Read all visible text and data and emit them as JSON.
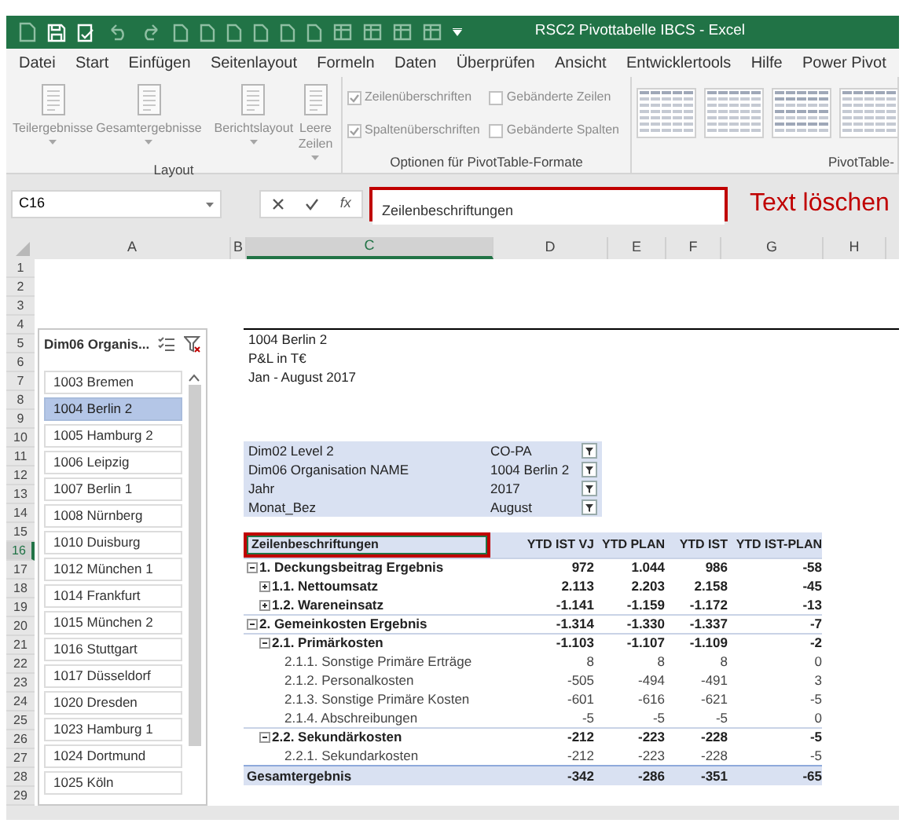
{
  "window": {
    "title": "RSC2 Pivottabelle IBCS  -  Excel"
  },
  "menu": [
    "Datei",
    "Start",
    "Einfügen",
    "Seitenlayout",
    "Formeln",
    "Daten",
    "Überprüfen",
    "Ansicht",
    "Entwicklertools",
    "Hilfe",
    "Power Pivot"
  ],
  "ribbon": {
    "groups": [
      {
        "label": "Layout",
        "kind": "buttons",
        "buttons": [
          {
            "label": "Teilergebnisse",
            "dropdown": true,
            "disabled": true
          },
          {
            "label": "Gesamtergebnisse",
            "dropdown": true,
            "disabled": true
          },
          {
            "label": "Berichtslayout",
            "dropdown": true,
            "disabled": true
          },
          {
            "label": "Leere Zeilen",
            "dropdown": true,
            "disabled": true
          }
        ]
      },
      {
        "label": "Optionen für PivotTable-Formate",
        "kind": "checkboxes",
        "checkboxes": [
          {
            "label": "Zeilenüberschriften",
            "checked": true,
            "disabled": true
          },
          {
            "label": "Gebänderte Zeilen",
            "checked": false,
            "disabled": true
          },
          {
            "label": "Spaltenüberschriften",
            "checked": true,
            "disabled": true
          },
          {
            "label": "Gebänderte Spalten",
            "checked": false,
            "disabled": true
          }
        ]
      },
      {
        "label": "PivotTable-",
        "kind": "gallery"
      }
    ]
  },
  "formula_bar": {
    "name_box": "C16",
    "insert_function": "fx",
    "formula": "Zeilenbeschriftungen"
  },
  "annotation": {
    "text": "Text löschen"
  },
  "sheet": {
    "columns": [
      {
        "label": "A",
        "selected": false
      },
      {
        "label": "B",
        "selected": false
      },
      {
        "label": "C",
        "selected": true
      },
      {
        "label": "D",
        "selected": false
      },
      {
        "label": "E",
        "selected": false
      },
      {
        "label": "F",
        "selected": false
      },
      {
        "label": "G",
        "selected": false
      },
      {
        "label": "H",
        "selected": false
      }
    ],
    "rows": [
      {
        "label": "1",
        "selected": false
      },
      {
        "label": "2",
        "selected": false
      },
      {
        "label": "3",
        "selected": false
      },
      {
        "label": "4",
        "selected": false
      },
      {
        "label": "5",
        "selected": false
      },
      {
        "label": "6",
        "selected": false
      },
      {
        "label": "7",
        "selected": false
      },
      {
        "label": "8",
        "selected": false
      },
      {
        "label": "9",
        "selected": false
      },
      {
        "label": "10",
        "selected": false
      },
      {
        "label": "11",
        "selected": false
      },
      {
        "label": "12",
        "selected": false
      },
      {
        "label": "13",
        "selected": false
      },
      {
        "label": "14",
        "selected": false
      },
      {
        "label": "15",
        "selected": false
      },
      {
        "label": "16",
        "selected": true
      },
      {
        "label": "17",
        "selected": false
      },
      {
        "label": "18",
        "selected": false
      },
      {
        "label": "19",
        "selected": false
      },
      {
        "label": "20",
        "selected": false
      },
      {
        "label": "21",
        "selected": false
      },
      {
        "label": "22",
        "selected": false
      },
      {
        "label": "23",
        "selected": false
      },
      {
        "label": "24",
        "selected": false
      },
      {
        "label": "25",
        "selected": false
      },
      {
        "label": "26",
        "selected": false
      },
      {
        "label": "27",
        "selected": false
      },
      {
        "label": "28",
        "selected": false
      },
      {
        "label": "29",
        "selected": false
      }
    ]
  },
  "slicer": {
    "title": "Dim06 Organis...",
    "items": [
      {
        "label": "1003 Bremen",
        "selected": false
      },
      {
        "label": "1004 Berlin 2",
        "selected": true
      },
      {
        "label": "1005 Hamburg 2",
        "selected": false
      },
      {
        "label": "1006 Leipzig",
        "selected": false
      },
      {
        "label": "1007 Berlin 1",
        "selected": false
      },
      {
        "label": "1008 Nürnberg",
        "selected": false
      },
      {
        "label": "1010 Duisburg",
        "selected": false
      },
      {
        "label": "1012 München 1",
        "selected": false
      },
      {
        "label": "1014 Frankfurt",
        "selected": false
      },
      {
        "label": "1015 München 2",
        "selected": false
      },
      {
        "label": "1016 Stuttgart",
        "selected": false
      },
      {
        "label": "1017 Düsseldorf",
        "selected": false
      },
      {
        "label": "1020 Dresden",
        "selected": false
      },
      {
        "label": "1023 Hamburg 1",
        "selected": false
      },
      {
        "label": "1024 Dortmund",
        "selected": false
      },
      {
        "label": "1025 Köln",
        "selected": false
      }
    ]
  },
  "report": {
    "header_lines": [
      "1004 Berlin 2",
      "P&L in T€",
      "Jan - August 2017"
    ],
    "filters": [
      {
        "field": "Dim02 Level 2",
        "value": "CO-PA"
      },
      {
        "field": "Dim06 Organisation NAME",
        "value": "1004 Berlin 2"
      },
      {
        "field": "Jahr",
        "value": "2017"
      },
      {
        "field": "Monat_Bez",
        "value": "August"
      }
    ],
    "pivot": {
      "columns": [
        "Zeilenbeschriftungen",
        "YTD IST VJ",
        "YTD PLAN",
        "YTD IST",
        "YTD IST-PLAN"
      ],
      "rows": [
        {
          "label": "1. Deckungsbeitrag Ergebnis",
          "expanded": true,
          "values": [
            "972",
            "1.044",
            "986",
            "-58"
          ],
          "children": [
            {
              "label": "1.1. Nettoumsatz",
              "expanded": false,
              "values": [
                "2.113",
                "2.203",
                "2.158",
                "-45"
              ]
            },
            {
              "label": "1.2. Wareneinsatz",
              "expanded": false,
              "values": [
                "-1.141",
                "-1.159",
                "-1.172",
                "-13"
              ]
            }
          ]
        },
        {
          "label": "2. Gemeinkosten Ergebnis",
          "expanded": true,
          "values": [
            "-1.314",
            "-1.330",
            "-1.337",
            "-7"
          ],
          "children": [
            {
              "label": "2.1. Primärkosten",
              "expanded": true,
              "values": [
                "-1.103",
                "-1.107",
                "-1.109",
                "-2"
              ],
              "children": [
                {
                  "label": "2.1.1. Sonstige Primäre Erträge",
                  "values": [
                    "8",
                    "8",
                    "8",
                    "0"
                  ]
                },
                {
                  "label": "2.1.2. Personalkosten",
                  "values": [
                    "-505",
                    "-494",
                    "-491",
                    "3"
                  ]
                },
                {
                  "label": "2.1.3. Sonstige Primäre Kosten",
                  "values": [
                    "-601",
                    "-616",
                    "-621",
                    "-5"
                  ]
                },
                {
                  "label": "2.1.4. Abschreibungen",
                  "values": [
                    "-5",
                    "-5",
                    "-5",
                    "0"
                  ]
                }
              ]
            },
            {
              "label": "2.2. Sekundärkosten",
              "expanded": true,
              "values": [
                "-212",
                "-223",
                "-228",
                "-5"
              ],
              "children": [
                {
                  "label": "2.2.1. Sekundarkosten",
                  "values": [
                    "-212",
                    "-223",
                    "-228",
                    "-5"
                  ]
                }
              ]
            }
          ]
        }
      ],
      "total": {
        "label": "Gesamtergebnis",
        "values": [
          "-342",
          "-286",
          "-351",
          "-65"
        ]
      }
    }
  }
}
